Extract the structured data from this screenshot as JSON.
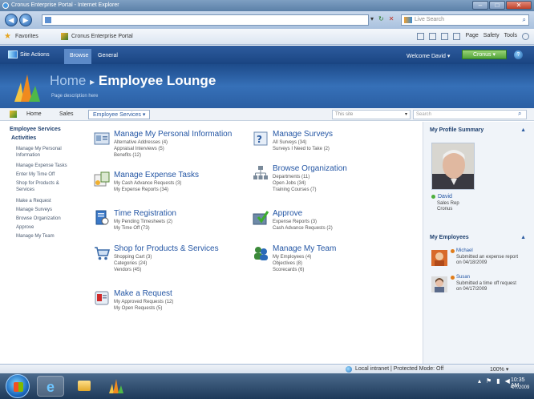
{
  "window": {
    "title": "Cronus Enterprise Portal - Internet Explorer",
    "controls": {
      "minimize": "–",
      "maximize": "□",
      "close": "✕"
    }
  },
  "addressbar": {
    "live_search_label": "Live Search"
  },
  "favorites_bar": {
    "favorites_label": "Favorites",
    "tab_title": "Cronus Enterprise Portal",
    "commands": [
      "Page",
      "Safety",
      "Tools"
    ]
  },
  "ribbon": {
    "site_actions": "Site Actions",
    "tabs": [
      "Browse",
      "General"
    ],
    "welcome": "Welcome David ▾",
    "site_button": "Cronus ▾"
  },
  "banner": {
    "breadcrumb_home": "Home",
    "breadcrumb_separator": "▸",
    "title": "Employee Lounge",
    "description": "Page description here"
  },
  "topnav": {
    "items": [
      "Home",
      "Sales"
    ],
    "employee_services": "Employee Services ▾",
    "scope": "This site",
    "search_placeholder": "Search"
  },
  "leftnav": {
    "heading": "Employee Services",
    "subheading": "Activities",
    "items": [
      "Manage My Personal Information",
      "Manage Expense Tasks",
      "Enter My Time Off",
      "Shop for Products & Services",
      "Make a Request",
      "Manage Surveys",
      "Browse Organization",
      "Approve",
      "Manage My Team"
    ]
  },
  "tiles": [
    {
      "title": "Manage My Personal Information",
      "icon": "personal-info-icon",
      "lines": [
        "Alternative Addresses (4)",
        "Appraisal Interviews (5)",
        "Benefits (12)"
      ]
    },
    {
      "title": "Manage Surveys",
      "icon": "survey-icon",
      "lines": [
        "All Surveys (34)",
        "Surveys I Need to Take (2)"
      ]
    },
    {
      "title": "Manage Expense Tasks",
      "icon": "expense-icon",
      "lines": [
        "My Cash Advance Requests (3)",
        "My Expense Reports (34)"
      ]
    },
    {
      "title": "Browse Organization",
      "icon": "org-chart-icon",
      "lines": [
        "Departments (11)",
        "Open Jobs (34)",
        "Training Courses (7)"
      ]
    },
    {
      "title": "Time Registration",
      "icon": "timesheet-icon",
      "lines": [
        "My Pending Timesheets (2)",
        "My Time Off (73)"
      ]
    },
    {
      "title": "Approve",
      "icon": "approve-icon",
      "lines": [
        "Expense Reports (3)",
        "Cash Advance Requests (2)"
      ]
    },
    {
      "title": "Shop for Products & Services",
      "icon": "shopping-cart-icon",
      "lines": [
        "Shopping Cart (3)",
        "Categories (24)",
        "Vendors (45)"
      ]
    },
    {
      "title": "Manage My Team",
      "icon": "team-icon",
      "lines": [
        "My Employees (4)",
        "Objectives (8)",
        "Scorecards (6)"
      ]
    },
    {
      "title": "Make a Request",
      "icon": "request-icon",
      "lines": [
        "My Approved Requests (12)",
        "My Open Requests (5)"
      ]
    }
  ],
  "profile": {
    "title": "My Profile Summary",
    "name": "David",
    "role": "Sales Rep",
    "company": "Cronus"
  },
  "employees": {
    "title": "My Employees",
    "items": [
      {
        "name": "Michael",
        "text": "Submitted an expense report on 04/18/2009"
      },
      {
        "name": "Susan",
        "text": "Submitted a time off request on 04/17/2009"
      }
    ]
  },
  "statusbar": {
    "zone": "Local intranet | Protected Mode: Off",
    "zoom": "100% ▾"
  },
  "taskbar": {
    "time": "10:35 AM",
    "date": "4/7/2009"
  },
  "colors": {
    "ribbon": "#1a4582",
    "banner": "#3670b8",
    "link": "#2456a4",
    "presence_available": "#4cae3c",
    "presence_busy": "#e07c1a"
  }
}
